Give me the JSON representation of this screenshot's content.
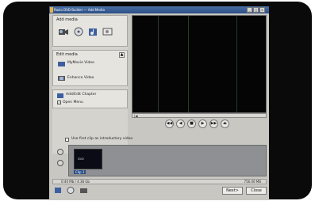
{
  "window": {
    "title": "Roxio DVD Builder — Add Media",
    "buttons": {
      "minimize": "_",
      "maximize": "□",
      "close": "×"
    }
  },
  "left_panel": {
    "add_media": {
      "heading": "Add media",
      "icons": [
        "video-camera-icon",
        "disc-icon",
        "music-note-icon",
        "slideshow-icon"
      ]
    },
    "edit_media": {
      "heading": "Edit media",
      "items": [
        {
          "label": "MyMovie Video",
          "icon": "movie-icon"
        },
        {
          "label": "Enhance Video",
          "icon": "enhance-icon"
        }
      ],
      "collapse": "▲"
    },
    "extra": {
      "add_chapter": "Add/Edit Chapter",
      "open_menu": "Open Menu",
      "open_menu_checked": true
    }
  },
  "preview": {
    "seek_indicator": "|◀"
  },
  "playback": {
    "buttons": [
      "◀◀",
      "◀",
      "■",
      "▶",
      "▶▶",
      "⏏"
    ]
  },
  "intro": {
    "label": "Use first clip as introductory video",
    "checked": false
  },
  "timeline": {
    "clips": [
      {
        "label": "Clip 1",
        "thumb_text": "DVD"
      }
    ]
  },
  "status": {
    "left": "0:40 Mb / 4.38 Gb",
    "right": "756.00 MB"
  },
  "footer": {
    "next": "Next>",
    "close": "Close"
  }
}
